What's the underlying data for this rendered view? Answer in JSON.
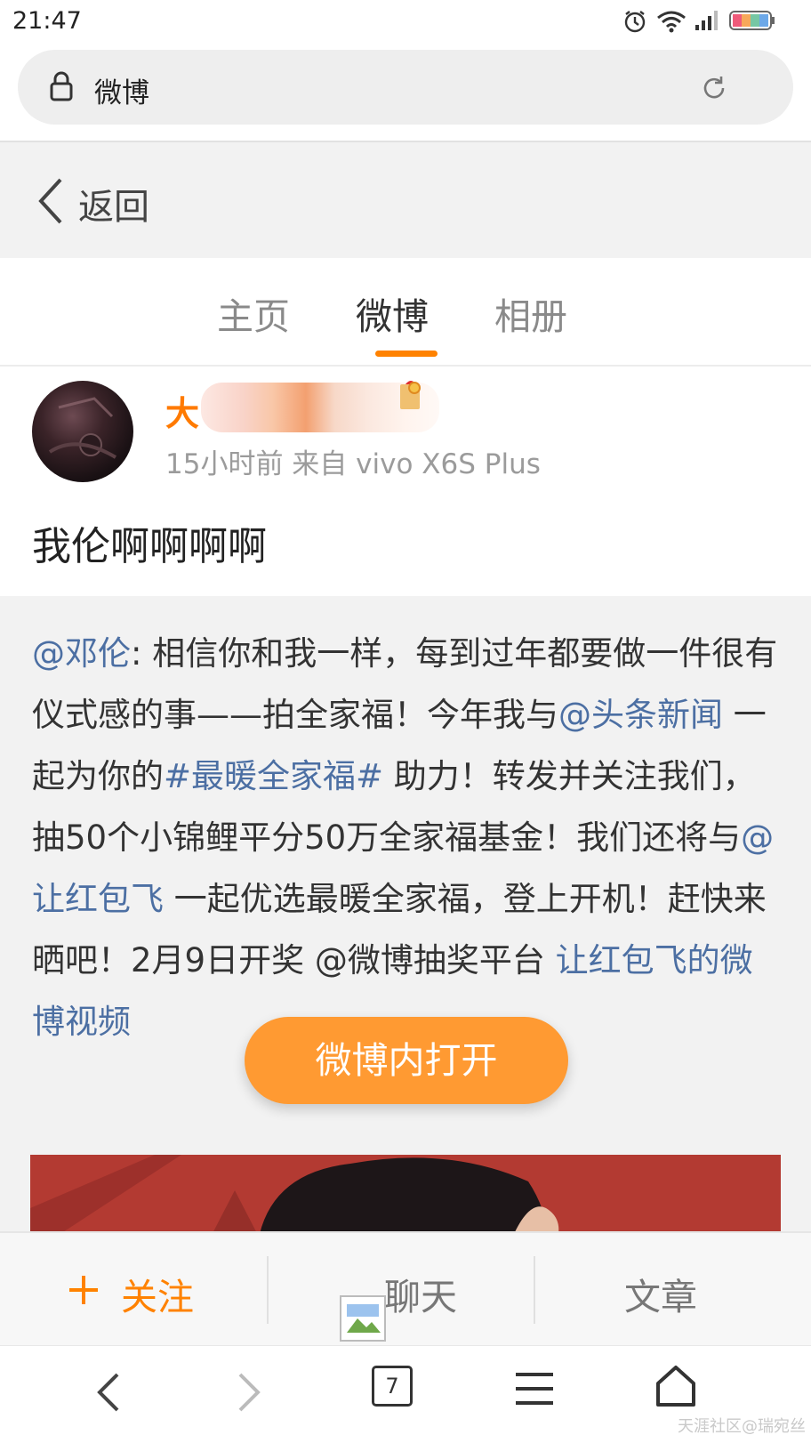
{
  "status_bar": {
    "time": "21:47"
  },
  "address_bar": {
    "title": "微博"
  },
  "back": {
    "label": "返回"
  },
  "tabs": [
    {
      "label": "主页",
      "active": false
    },
    {
      "label": "微博",
      "active": true
    },
    {
      "label": "相册",
      "active": false
    }
  ],
  "post": {
    "user_name_visible": "大",
    "meta": "15小时前 来自 vivo X6S Plus",
    "text": "我伦啊啊啊啊"
  },
  "repost": {
    "segments": [
      {
        "text": "@邓伦",
        "link": true
      },
      {
        "text": ": 相信你和我一样，每到过年都要做一件很有仪式感的事——拍全家福！今年我与",
        "link": false
      },
      {
        "text": "@头条新闻",
        "link": true
      },
      {
        "text": " 一起为你的",
        "link": false
      },
      {
        "text": "#最暖全家福#",
        "link": true
      },
      {
        "text": " 助力！转发并关注我们，抽50个小锦鲤平分50万全家福基金！我们还将与",
        "link": false
      },
      {
        "text": "@让红包飞",
        "link": true
      },
      {
        "text": " 一起优选最暖全家福，登上开机！赶快来晒吧！2月9日开奖 @微博",
        "link": false
      },
      {
        "text": "抽奖平台 ",
        "link": false
      },
      {
        "text": "让红包飞的微博视频",
        "link": true
      }
    ]
  },
  "floating_button": {
    "label": "微博内打开"
  },
  "actions": {
    "follow": "关注",
    "chat": "聊天",
    "article": "文章"
  },
  "nav": {
    "tab_count": "7"
  },
  "watermark": "天涯社区@瑞宛丝",
  "colors": {
    "accent": "#ff8200",
    "link": "#4c6fa3",
    "button": "#ff9a32"
  }
}
